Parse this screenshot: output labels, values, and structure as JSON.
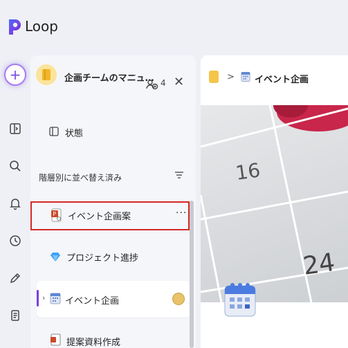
{
  "app": {
    "title": "Loop"
  },
  "workspace": {
    "name": "企画チームのマニュ…",
    "member_count": "4"
  },
  "sidebar": {
    "status_label": "状態",
    "section_title": "階層別に並べ替え済み",
    "items": [
      {
        "label": "イベント企画案",
        "icon": "powerpoint-icon"
      },
      {
        "label": "プロジェクト進捗",
        "icon": "diamond-icon"
      },
      {
        "label": "イベント企画",
        "icon": "calendar-icon"
      },
      {
        "label": "提案資料作成",
        "icon": "document-icon"
      }
    ],
    "more_label": "···"
  },
  "breadcrumb": {
    "separator": ">",
    "page": "イベント企画"
  },
  "cover": {
    "numbers": [
      "16",
      "24"
    ]
  },
  "colors": {
    "accent": "#7b3fe4",
    "highlight": "#d62828",
    "workspace_icon_bg": "#fbe49a"
  }
}
